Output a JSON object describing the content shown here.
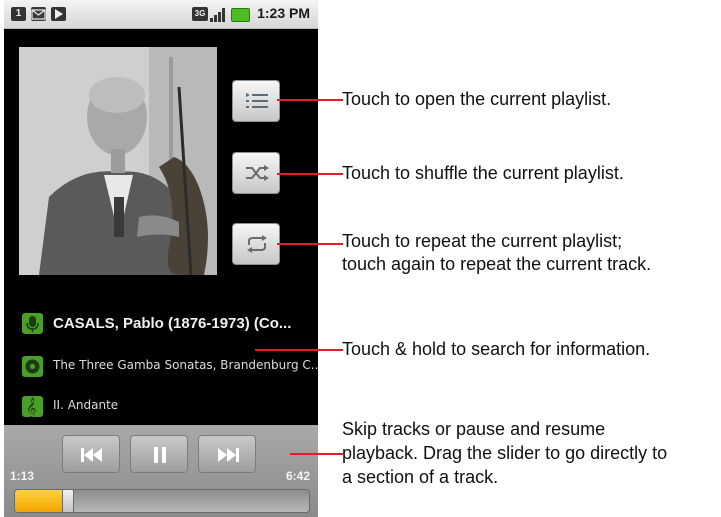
{
  "status_bar": {
    "time": "1:23 PM",
    "network_badge": "3G",
    "notification_icons": [
      "sim-icon",
      "gmail-icon",
      "play-icon"
    ]
  },
  "album_art": {
    "description_icon": "album-art-photo"
  },
  "controls": {
    "playlist_icon": "playlist-icon",
    "shuffle_icon": "shuffle-icon",
    "repeat_icon": "repeat-icon"
  },
  "now_playing": {
    "artist": "CASALS, Pablo (1876-1973) (Co...",
    "album": "The Three Gamba Sonatas, Brandenburg C...",
    "track": "II. Andante"
  },
  "transport": {
    "elapsed": "1:13",
    "duration": "6:42",
    "progress_fraction": 0.18
  },
  "callouts": {
    "playlist": "Touch to open the current playlist.",
    "shuffle": "Touch to shuffle the current playlist.",
    "repeat_line1": "Touch to repeat the current playlist;",
    "repeat_line2": "touch again to repeat the current track.",
    "search": "Touch & hold to search for information.",
    "skip_line1": "Skip tracks or pause and resume",
    "skip_line2": "playback. Drag the slider to go directly to",
    "skip_line3": "a section of a track."
  },
  "colors": {
    "accent_green": "#4a9f2a",
    "callout_red": "#e51c23",
    "progress_yellow": "#f2a400"
  }
}
